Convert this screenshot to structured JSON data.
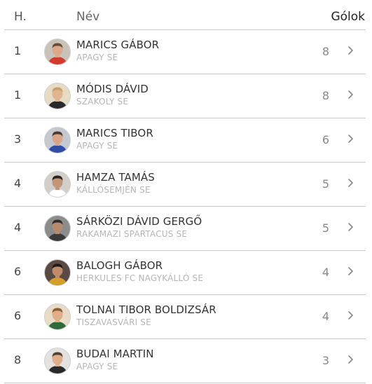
{
  "header": {
    "rank_label": "H.",
    "name_label": "Név",
    "goals_label": "Gólok"
  },
  "rows": [
    {
      "rank": "1",
      "name": "MARICS GÁBOR",
      "club": "APAGY SE",
      "goals": "8",
      "avatar_bg": "#c9c2b8",
      "skin": "#d9a98a",
      "hair": "#6b4a38",
      "shirt": "#d43a2e"
    },
    {
      "rank": "1",
      "name": "MÓDIS DÁVID",
      "club": "SZAKOLY SE",
      "goals": "8",
      "avatar_bg": "#e6dcc6",
      "skin": "#e0b48f",
      "hair": "#c9a06a",
      "shirt": "#2a2a2a"
    },
    {
      "rank": "3",
      "name": "MARICS TIBOR",
      "club": "APAGY SE",
      "goals": "6",
      "avatar_bg": "#c4c8cf",
      "skin": "#d6a58a",
      "hair": "#4a3a30",
      "shirt": "#2e4ea6"
    },
    {
      "rank": "4",
      "name": "HAMZA TAMÁS",
      "club": "KÁLLÓSEMJÉN SE",
      "goals": "5",
      "avatar_bg": "#d2cfcb",
      "skin": "#c49478",
      "hair": "#2a2220",
      "shirt": "#ffffff"
    },
    {
      "rank": "4",
      "name": "SÁRKÖZI DÁVID GERGŐ",
      "club": "RAKAMAZI SPARTACUS SE",
      "goals": "5",
      "avatar_bg": "#8c8c8c",
      "skin": "#b58a6e",
      "hair": "#2d2d2d",
      "shirt": "#3a3a3a"
    },
    {
      "rank": "6",
      "name": "BALOGH GÁBOR",
      "club": "HERKULES FC NAGYKÁLLÓ SE",
      "goals": "4",
      "avatar_bg": "#5a4a44",
      "skin": "#c08a6c",
      "hair": "#1e1a18",
      "shirt": "#d4a02a"
    },
    {
      "rank": "6",
      "name": "TOLNAI TIBOR BOLDIZSÁR",
      "club": "TISZAVASVÁRI SE",
      "goals": "4",
      "avatar_bg": "#e8dcc8",
      "skin": "#e0ad88",
      "hair": "#8a6038",
      "shirt": "#2f6a3a"
    },
    {
      "rank": "8",
      "name": "BUDAI MARTIN",
      "club": "APAGY SE",
      "goals": "3",
      "avatar_bg": "#e4e2de",
      "skin": "#deae8f",
      "hair": "#5a4030",
      "shirt": "#2a2a2a"
    }
  ]
}
